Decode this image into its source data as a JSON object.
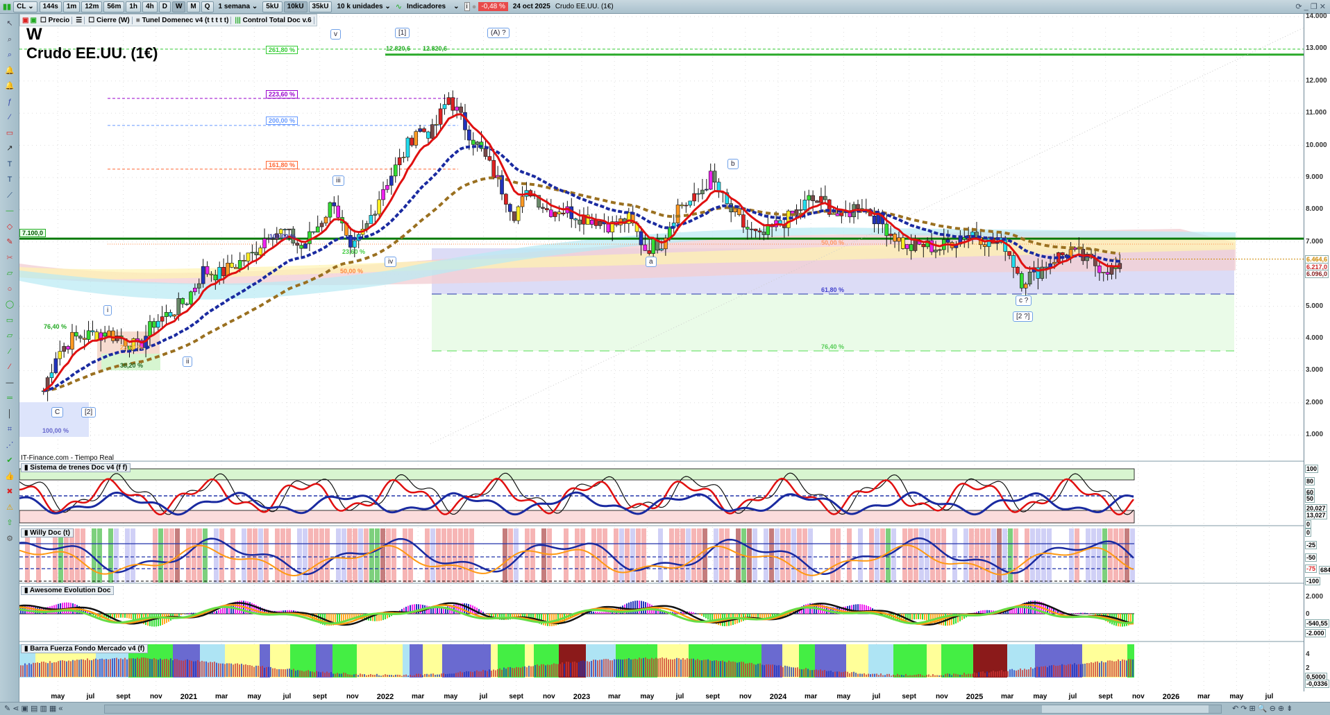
{
  "toolbar": {
    "symbol": "CL",
    "intervals": [
      "144s",
      "1m",
      "12m",
      "56m",
      "1h",
      "4h",
      "D",
      "W",
      "M",
      "Q"
    ],
    "active_interval": "W",
    "period": "1 semana",
    "units": [
      "5kU",
      "10kU",
      "35kU"
    ],
    "active_unit": "10kU",
    "units_select": "10 k unidades",
    "indicators": "Indicadores",
    "change": "-0,48 %",
    "date": "24 oct 2025",
    "instrument": "Crudo EE.UU. (1€)"
  },
  "legend": {
    "items": [
      "Precio",
      "Cierre (W)",
      "Tunel Domenec v4 (t t t t t)",
      "Control Total Doc v.6"
    ]
  },
  "main": {
    "timeframe": "W",
    "title": "Crudo EE.UU. (1€)",
    "source": "IT-Finance.com - Tiempo Real",
    "fib_labels": [
      {
        "text": "261,80 %",
        "price": 12990,
        "color": "#33cc33"
      },
      {
        "text": "223,60 %",
        "price": 11460,
        "color": "#9900cc"
      },
      {
        "text": "200,00 %",
        "price": 10620,
        "color": "#6699ff"
      },
      {
        "text": "161,80 %",
        "price": 9260,
        "color": "#ff6633"
      }
    ],
    "peak_labels": [
      "12.820,6",
      "12.820,6"
    ],
    "level_7100": "7.100,0",
    "zone_labels": [
      "50,00 %",
      "61,80 %",
      "76,40 %"
    ],
    "left_fib_labels": [
      "76,40 %",
      "38,20 %",
      "100,00 %",
      "50,00 %",
      "23,60 %",
      "23,60 %",
      "100,00 %"
    ],
    "wave_labels": [
      "v",
      "[1]",
      "(A) ?",
      "iii",
      "iv",
      "i",
      "ii",
      "[2]",
      "C",
      "b",
      "a",
      "c ?",
      "[2 ?]"
    ]
  },
  "price_axis": {
    "ticks": [
      "14.000",
      "13.000",
      "12.000",
      "11.000",
      "10.000",
      "9.000",
      "8.000",
      "7.000",
      "5.000",
      "4.000",
      "3.000",
      "2.000",
      "1.000"
    ],
    "markers": [
      "6.464,6",
      "6.217,0",
      "6.096,0"
    ]
  },
  "panels": [
    {
      "title": "Sistema de trenes Doc v4 (f f)",
      "axis": [
        "100",
        "80",
        "60",
        "50",
        "20,027",
        "13,027",
        "0"
      ]
    },
    {
      "title": "Willy Doc (t)",
      "axis": [
        "0",
        "-25",
        "-50",
        "-75",
        "-100",
        "684"
      ]
    },
    {
      "title": "Awesome Evolution Doc",
      "axis": [
        "2.000",
        "0",
        "-540,55",
        "-2.000"
      ]
    },
    {
      "title": "Barra Fuerza Fondo Mercado v4 (f)",
      "axis": [
        "4",
        "2",
        "0,5000",
        "-0,0336"
      ]
    }
  ],
  "time_axis": [
    "may",
    "jul",
    "sept",
    "nov",
    "2021",
    "mar",
    "may",
    "jul",
    "sept",
    "nov",
    "2022",
    "mar",
    "may",
    "jul",
    "sept",
    "nov",
    "2023",
    "mar",
    "may",
    "jul",
    "sept",
    "nov",
    "2024",
    "mar",
    "may",
    "jul",
    "sept",
    "nov",
    "2025",
    "mar",
    "may",
    "jul",
    "sept",
    "nov",
    "2026",
    "mar",
    "may",
    "jul"
  ],
  "chart_data": {
    "type": "candlestick",
    "title": "Crudo EE.UU. (1€)",
    "interval": "weekly",
    "start": "2020-04",
    "resolution": "monthly close (approx.)",
    "closes": [
      2000,
      3500,
      4000,
      4100,
      4200,
      4000,
      3700,
      4500,
      4800,
      5200,
      6100,
      6000,
      6300,
      6600,
      7300,
      7300,
      6800,
      7500,
      8300,
      6600,
      7500,
      8700,
      9500,
      10500,
      10400,
      11500,
      10600,
      9800,
      8900,
      7900,
      8600,
      8000,
      8000,
      7800,
      7700,
      7500,
      7700,
      6800,
      7000,
      8100,
      8300,
      9000,
      8100,
      7500,
      7100,
      7500,
      7800,
      8300,
      8200,
      7700,
      8200,
      7800,
      7300,
      6800,
      6900,
      6800,
      7100,
      7300,
      7000,
      6900,
      5800,
      6100,
      6500,
      6700,
      6400,
      6200,
      6100
    ],
    "horizontal_levels": [
      12820.6,
      7100
    ],
    "ylim": [
      0,
      14000
    ],
    "colors": {
      "up": "#33dd33",
      "down": "#dd2222",
      "ma_fast": "#e01010",
      "ma_mid": "#1a2aa0",
      "ma_slow": "#9a7020"
    }
  }
}
